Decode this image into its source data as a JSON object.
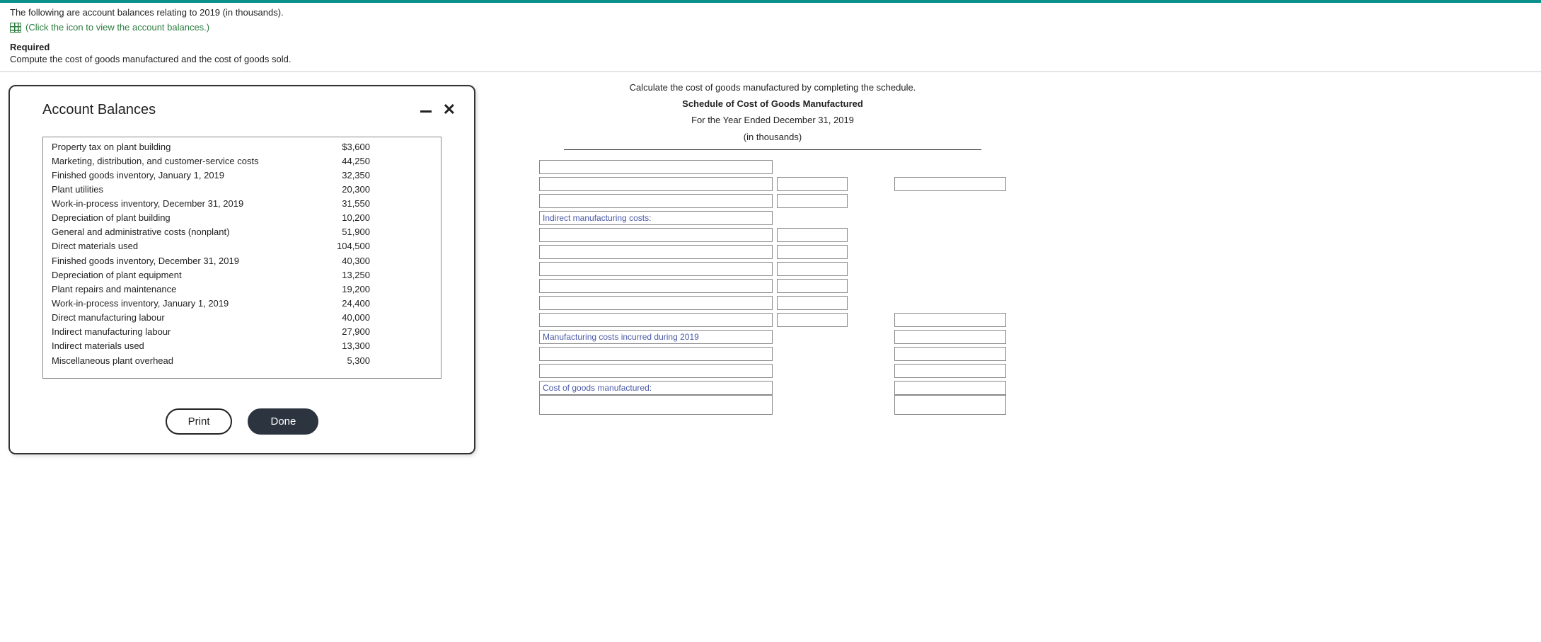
{
  "intro": "The following are account balances relating to 2019 (in thousands).",
  "icon_link_text": "(Click the icon to view the account balances.)",
  "required_heading": "Required",
  "required_text": "Compute the cost of goods manufactured and the cost of goods sold.",
  "modal": {
    "title": "Account Balances",
    "print": "Print",
    "done": "Done"
  },
  "balances": [
    {
      "label": "Property tax on plant building",
      "value": "$3,600"
    },
    {
      "label": "Marketing, distribution, and customer-service costs",
      "value": "44,250"
    },
    {
      "label": "Finished goods inventory, January 1, 2019",
      "value": "32,350"
    },
    {
      "label": "Plant utilities",
      "value": "20,300"
    },
    {
      "label": "Work-in-process inventory, December 31, 2019",
      "value": "31,550"
    },
    {
      "label": "Depreciation of plant building",
      "value": "10,200"
    },
    {
      "label": "General and administrative costs (nonplant)",
      "value": "51,900"
    },
    {
      "label": "Direct materials used",
      "value": "104,500"
    },
    {
      "label": "Finished goods inventory, December 31, 2019",
      "value": "40,300"
    },
    {
      "label": "Depreciation of plant equipment",
      "value": "13,250"
    },
    {
      "label": "Plant repairs and maintenance",
      "value": "19,200"
    },
    {
      "label": "Work-in-process inventory, January 1, 2019",
      "value": "24,400"
    },
    {
      "label": "Direct manufacturing labour",
      "value": "40,000"
    },
    {
      "label": "Indirect manufacturing labour",
      "value": "27,900"
    },
    {
      "label": "Indirect materials used",
      "value": "13,300"
    },
    {
      "label": "Miscellaneous plant overhead",
      "value": "5,300"
    }
  ],
  "schedule": {
    "instruction": "Calculate the cost of goods manufactured by completing the schedule.",
    "title": "Schedule of Cost of Goods Manufactured",
    "subtitle": "For the Year Ended December 31, 2019",
    "units": "(in thousands)",
    "row_indirect": "Indirect manufacturing costs:",
    "row_mfg_costs": "Manufacturing costs incurred during 2019",
    "row_cogm": "Cost of goods manufactured:"
  }
}
